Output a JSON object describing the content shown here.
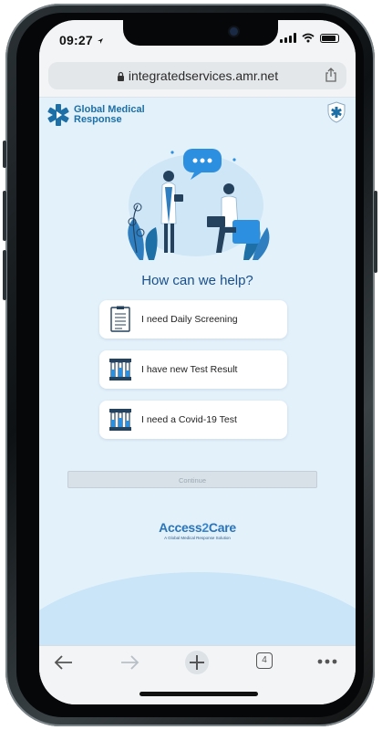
{
  "status_bar": {
    "time": "09:27"
  },
  "browser": {
    "url": "integratedservices.amr.net",
    "tab_count": "4"
  },
  "header": {
    "logo_line1": "Global Medical",
    "logo_line2": "Response"
  },
  "main": {
    "heading": "How can we help?",
    "options": [
      {
        "label": "I need Daily Screening",
        "icon": "clipboard-icon"
      },
      {
        "label": "I have new Test Result",
        "icon": "test-tubes-icon"
      },
      {
        "label": "I need a Covid-19 Test",
        "icon": "test-tubes-icon"
      }
    ],
    "continue_label": "Continue"
  },
  "footer_logo": {
    "name_part1": "Access",
    "name_part2": "2",
    "name_part3": "Care",
    "tagline": "A Global Medical Response Solution"
  },
  "colors": {
    "accent": "#1d6fa6",
    "heading": "#1a4f8a",
    "background": "#e3f1fb"
  }
}
